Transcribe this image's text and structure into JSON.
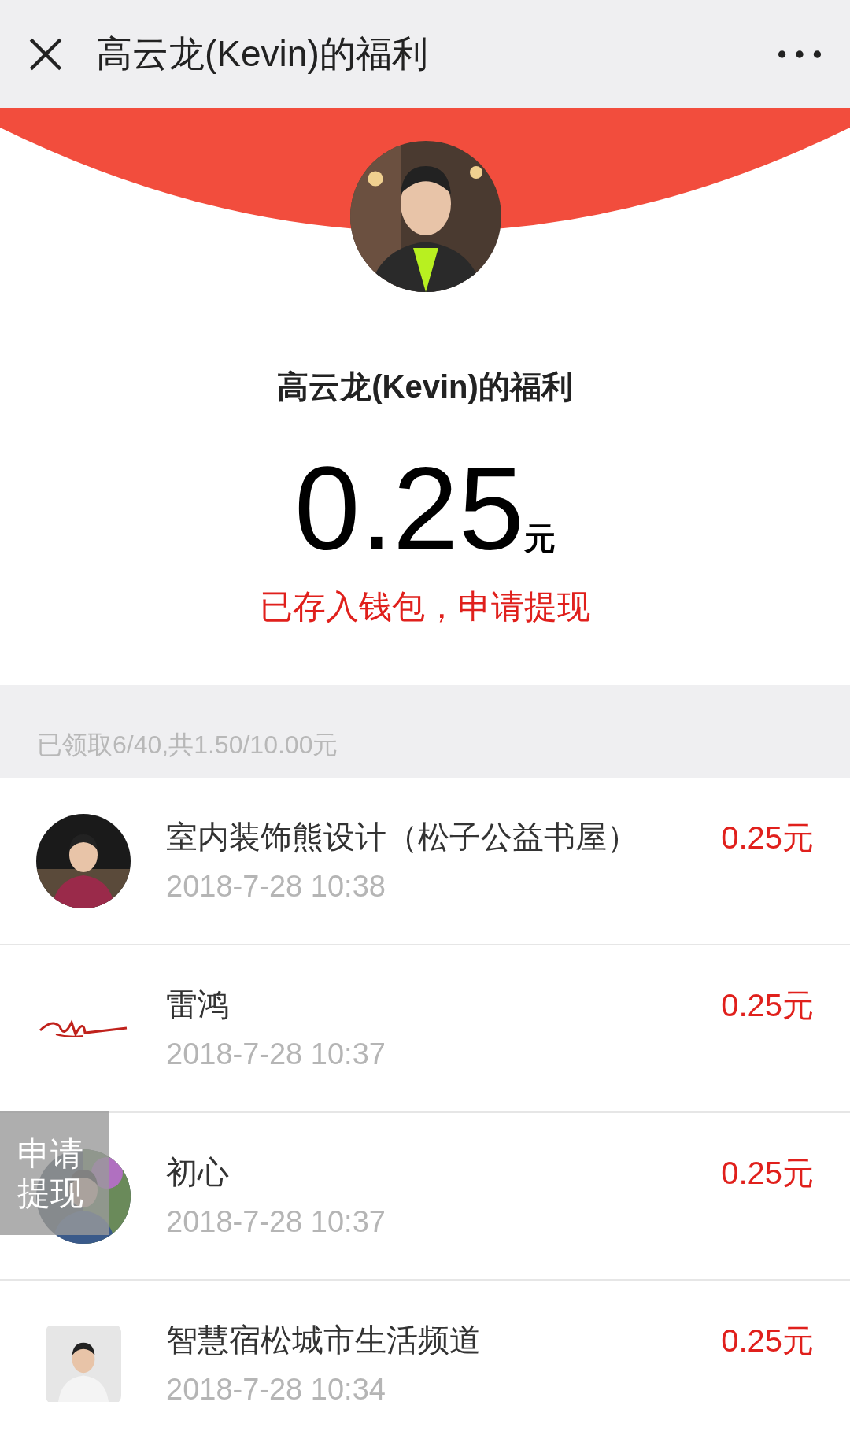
{
  "header": {
    "title": "高云龙(Kevin)的福利"
  },
  "packet": {
    "title": "高云龙(Kevin)的福利",
    "amount": "0.25",
    "unit": "元",
    "link": "已存入钱包，申请提现"
  },
  "summary": "已领取6/40,共1.50/10.00元",
  "records": [
    {
      "name": "室内装饰熊设计（松子公益书屋）",
      "time": "2018-7-28 10:38",
      "amount": "0.25元"
    },
    {
      "name": "雷鸿",
      "time": "2018-7-28 10:37",
      "amount": "0.25元"
    },
    {
      "name": "初心",
      "time": "2018-7-28 10:37",
      "amount": "0.25元"
    },
    {
      "name": "智慧宿松城市生活频道",
      "time": "2018-7-28 10:34",
      "amount": "0.25元"
    }
  ],
  "floating_button": "申请提现"
}
